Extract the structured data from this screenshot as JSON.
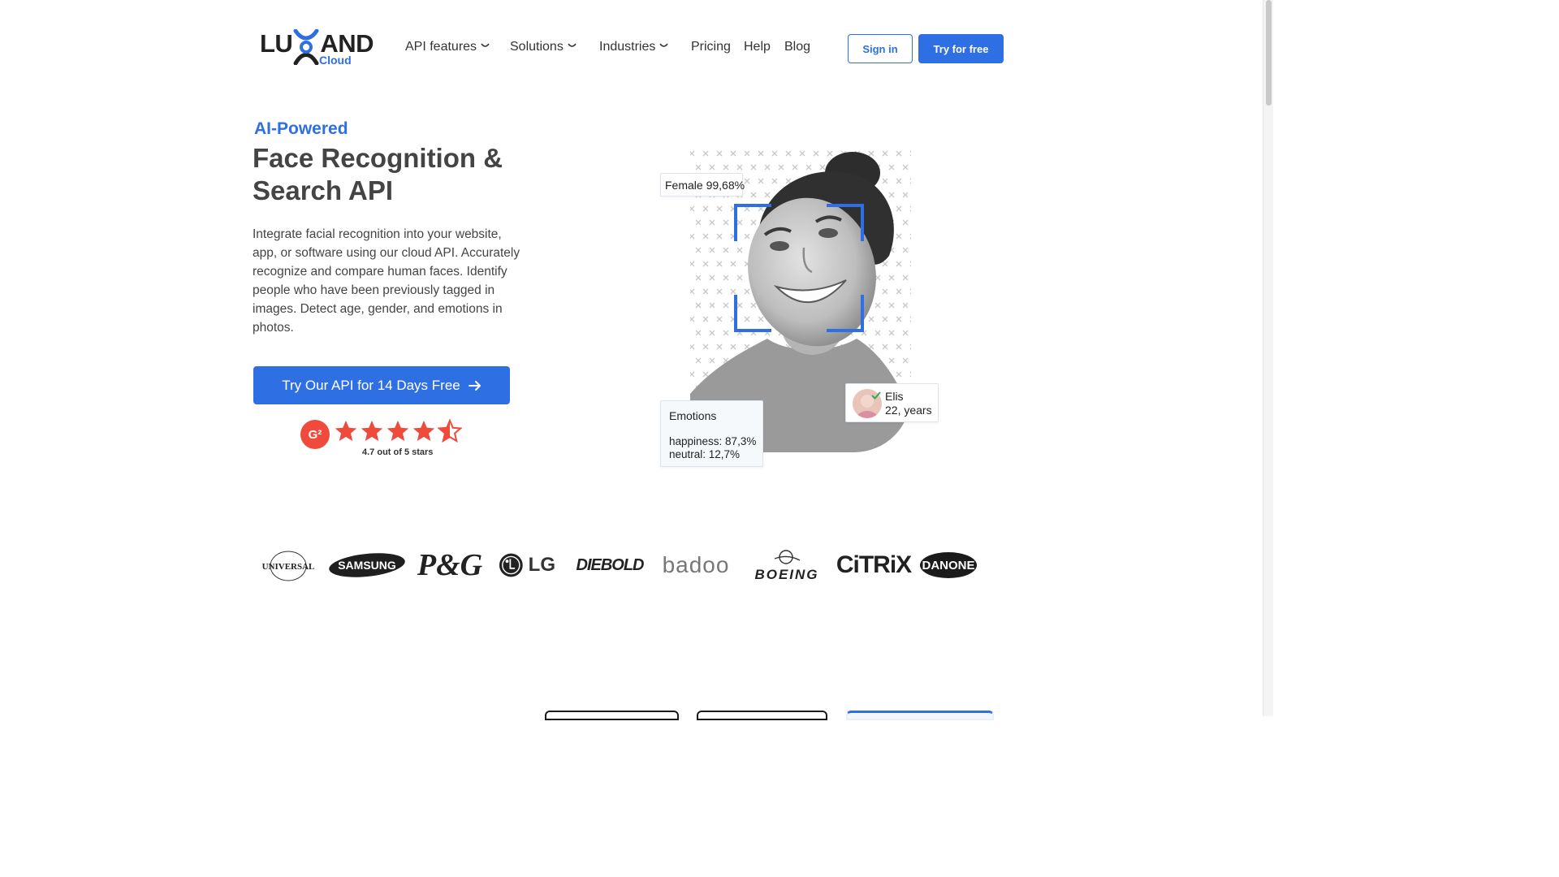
{
  "brand": {
    "logo_text": "LUXAND",
    "logo_sub": "Cloud",
    "accent": "#2f6fe4",
    "dark": "#222222"
  },
  "nav": {
    "items": [
      {
        "label": "API features",
        "dropdown": true
      },
      {
        "label": "Solutions",
        "dropdown": true
      },
      {
        "label": "Industries",
        "dropdown": true
      },
      {
        "label": "Pricing",
        "dropdown": false
      },
      {
        "label": "Help",
        "dropdown": false
      },
      {
        "label": "Blog",
        "dropdown": false
      }
    ],
    "sign_in": "Sign in",
    "try_free": "Try for free"
  },
  "hero": {
    "kicker": "AI-Powered",
    "title": "Face Recognition & Search API",
    "description": "Integrate facial recognition into your website, app, or software using our cloud API. Accurately recognize and compare human faces. Identify people who have been previously tagged in images. Detect age, gender, and emotions in photos.",
    "cta": "Try Our API for 14 Days Free",
    "rating": {
      "badge": "G²",
      "stars": 4.7,
      "caption": "4.7 out of 5 stars",
      "star_color": "#ef4a3b"
    }
  },
  "demo": {
    "gender_tag": "Female 99,68%",
    "person": {
      "name": "Elis",
      "age": "22, years"
    },
    "emotions": {
      "title": "Emotions",
      "lines": [
        "happiness: 87,3%",
        "neutral: 12,7%"
      ]
    }
  },
  "clients": [
    "UNIVERSAL",
    "SAMSUNG",
    "P&G",
    "LG",
    "DIEBOLD",
    "badoo",
    "BOEING",
    "CiTRiX",
    "DANONE"
  ]
}
